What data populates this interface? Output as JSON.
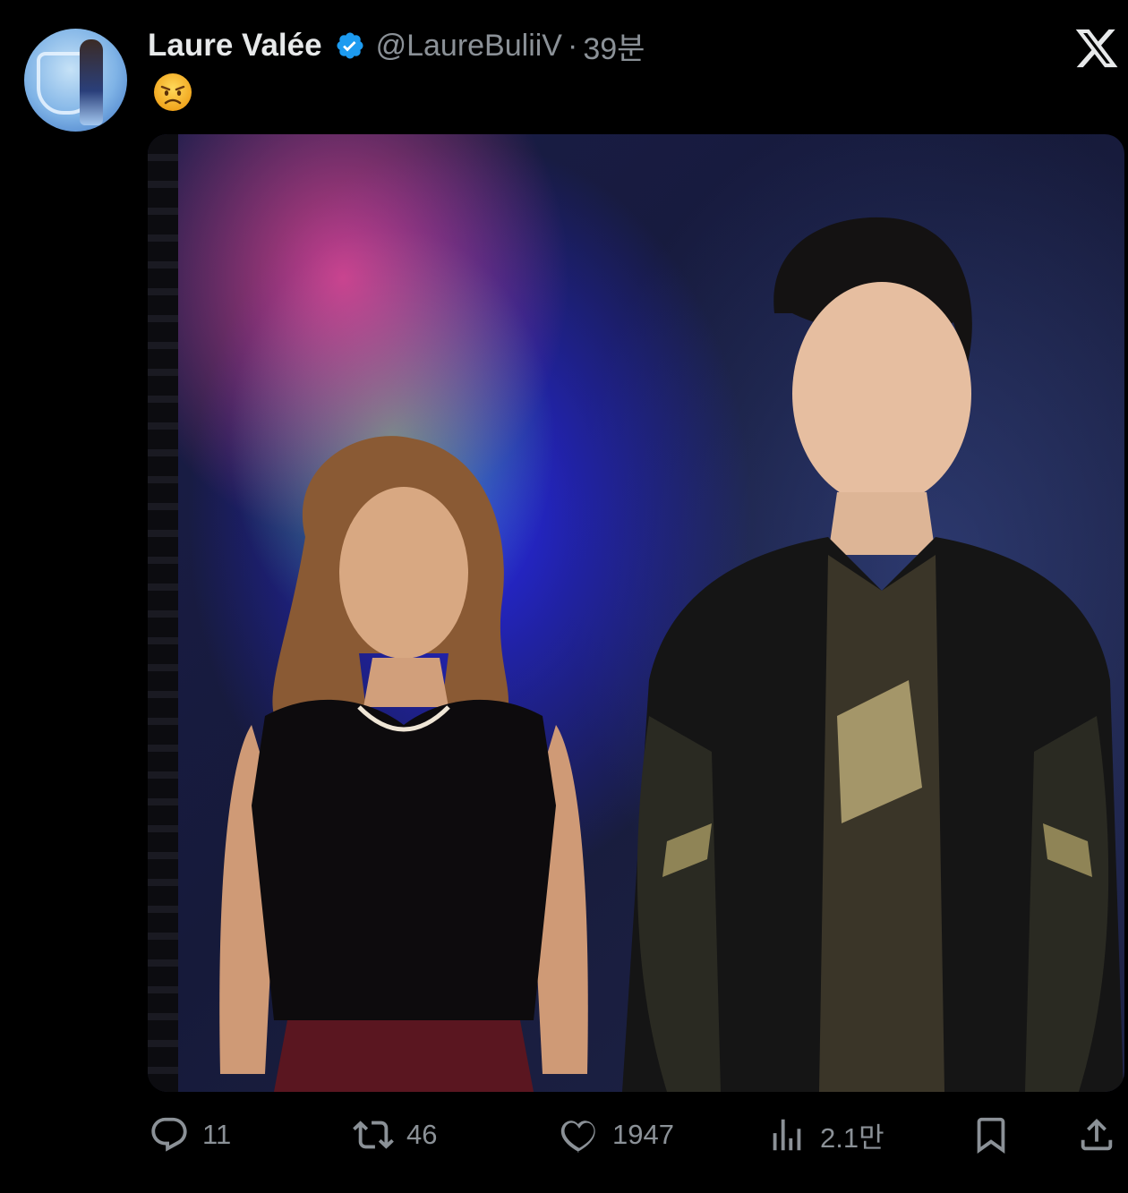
{
  "author": {
    "display_name": "Laure Valée",
    "handle": "@LaureBuliiV",
    "separator": "·",
    "time": "39분",
    "verified": true,
    "avatar_icon": "profile-photo"
  },
  "brand_icon": "x-logo-icon",
  "tweet": {
    "text_emoji": "angry-face-emoji",
    "media": {
      "type": "photo",
      "left_person": "woman in black lace top with pearl necklace",
      "right_person": "man in black team jacket"
    }
  },
  "actions": {
    "reply": {
      "icon": "reply-icon",
      "count": "11"
    },
    "retweet": {
      "icon": "retweet-icon",
      "count": "46"
    },
    "like": {
      "icon": "heart-icon",
      "count": "1947"
    },
    "views": {
      "icon": "views-icon",
      "count": "2.1만"
    },
    "bookmark": {
      "icon": "bookmark-icon"
    },
    "share": {
      "icon": "share-icon"
    }
  },
  "colors": {
    "background": "#000000",
    "text_primary": "#e7e9ea",
    "text_secondary": "#8b9197",
    "verified_blue": "#1d9bf0"
  }
}
